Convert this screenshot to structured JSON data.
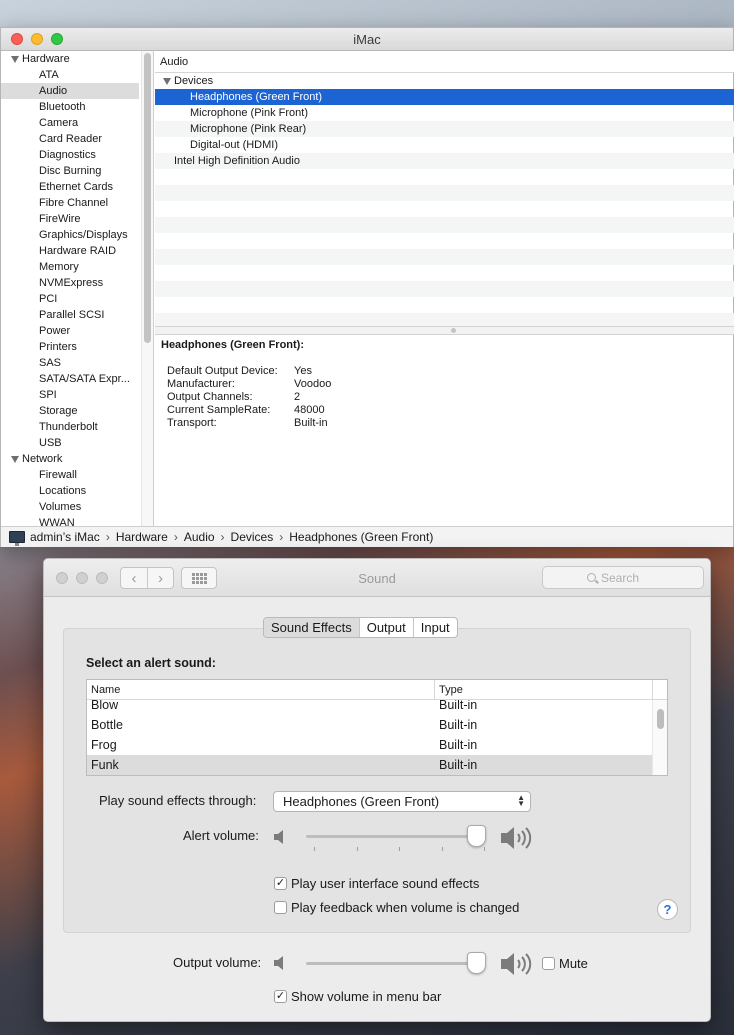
{
  "system_info": {
    "title": "iMac",
    "sidebar": [
      {
        "kind": "group",
        "label": "Hardware"
      },
      {
        "kind": "item",
        "label": "ATA"
      },
      {
        "kind": "item",
        "label": "Audio",
        "selected": true
      },
      {
        "kind": "item",
        "label": "Bluetooth"
      },
      {
        "kind": "item",
        "label": "Camera"
      },
      {
        "kind": "item",
        "label": "Card Reader"
      },
      {
        "kind": "item",
        "label": "Diagnostics"
      },
      {
        "kind": "item",
        "label": "Disc Burning"
      },
      {
        "kind": "item",
        "label": "Ethernet Cards"
      },
      {
        "kind": "item",
        "label": "Fibre Channel"
      },
      {
        "kind": "item",
        "label": "FireWire"
      },
      {
        "kind": "item",
        "label": "Graphics/Displays"
      },
      {
        "kind": "item",
        "label": "Hardware RAID"
      },
      {
        "kind": "item",
        "label": "Memory"
      },
      {
        "kind": "item",
        "label": "NVMExpress"
      },
      {
        "kind": "item",
        "label": "PCI"
      },
      {
        "kind": "item",
        "label": "Parallel SCSI"
      },
      {
        "kind": "item",
        "label": "Power"
      },
      {
        "kind": "item",
        "label": "Printers"
      },
      {
        "kind": "item",
        "label": "SAS"
      },
      {
        "kind": "item",
        "label": "SATA/SATA Expr..."
      },
      {
        "kind": "item",
        "label": "SPI"
      },
      {
        "kind": "item",
        "label": "Storage"
      },
      {
        "kind": "item",
        "label": "Thunderbolt"
      },
      {
        "kind": "item",
        "label": "USB"
      },
      {
        "kind": "group",
        "label": "Network"
      },
      {
        "kind": "item",
        "label": "Firewall"
      },
      {
        "kind": "item",
        "label": "Locations"
      },
      {
        "kind": "item",
        "label": "Volumes"
      },
      {
        "kind": "item",
        "label": "WWAN"
      }
    ],
    "content_header": "Audio",
    "tree": [
      {
        "label": "Devices",
        "level": 0,
        "expanded": true
      },
      {
        "label": "Headphones (Green Front)",
        "level": 1,
        "selected": true
      },
      {
        "label": "Microphone (Pink Front)",
        "level": 1
      },
      {
        "label": "Microphone (Pink Rear)",
        "level": 1
      },
      {
        "label": "Digital-out (HDMI)",
        "level": 1
      },
      {
        "label": "Intel High Definition Audio",
        "level": 0
      }
    ],
    "detail_title": "Headphones (Green Front):",
    "details": [
      {
        "key": "Default Output Device:",
        "value": "Yes"
      },
      {
        "key": "Manufacturer:",
        "value": "Voodoo"
      },
      {
        "key": "Output Channels:",
        "value": "2"
      },
      {
        "key": "Current SampleRate:",
        "value": "48000"
      },
      {
        "key": "Transport:",
        "value": "Built-in"
      }
    ],
    "breadcrumb": [
      "admin’s iMac",
      "Hardware",
      "Audio",
      "Devices",
      "Headphones (Green Front)"
    ]
  },
  "sound_prefs": {
    "title": "Sound",
    "search_placeholder": "Search",
    "tabs": [
      {
        "label": "Sound Effects",
        "active": true
      },
      {
        "label": "Output"
      },
      {
        "label": "Input"
      }
    ],
    "alert_label": "Select an alert sound:",
    "columns": {
      "name": "Name",
      "type": "Type"
    },
    "alerts": [
      {
        "name": "Blow",
        "type": "Built-in"
      },
      {
        "name": "Bottle",
        "type": "Built-in"
      },
      {
        "name": "Frog",
        "type": "Built-in"
      },
      {
        "name": "Funk",
        "type": "Built-in",
        "selected": true
      }
    ],
    "play_through_label": "Play sound effects through:",
    "play_through_value": "Headphones (Green Front)",
    "alert_volume_label": "Alert volume:",
    "alert_volume_level": 1.0,
    "ui_sounds_label": "Play user interface sound effects",
    "ui_sounds_checked": true,
    "feedback_label": "Play feedback when volume is changed",
    "feedback_checked": false,
    "help_label": "?",
    "output_volume_label": "Output volume:",
    "output_volume_level": 1.0,
    "mute_label": "Mute",
    "mute_checked": false,
    "menubar_label": "Show volume in menu bar",
    "menubar_checked": true
  }
}
